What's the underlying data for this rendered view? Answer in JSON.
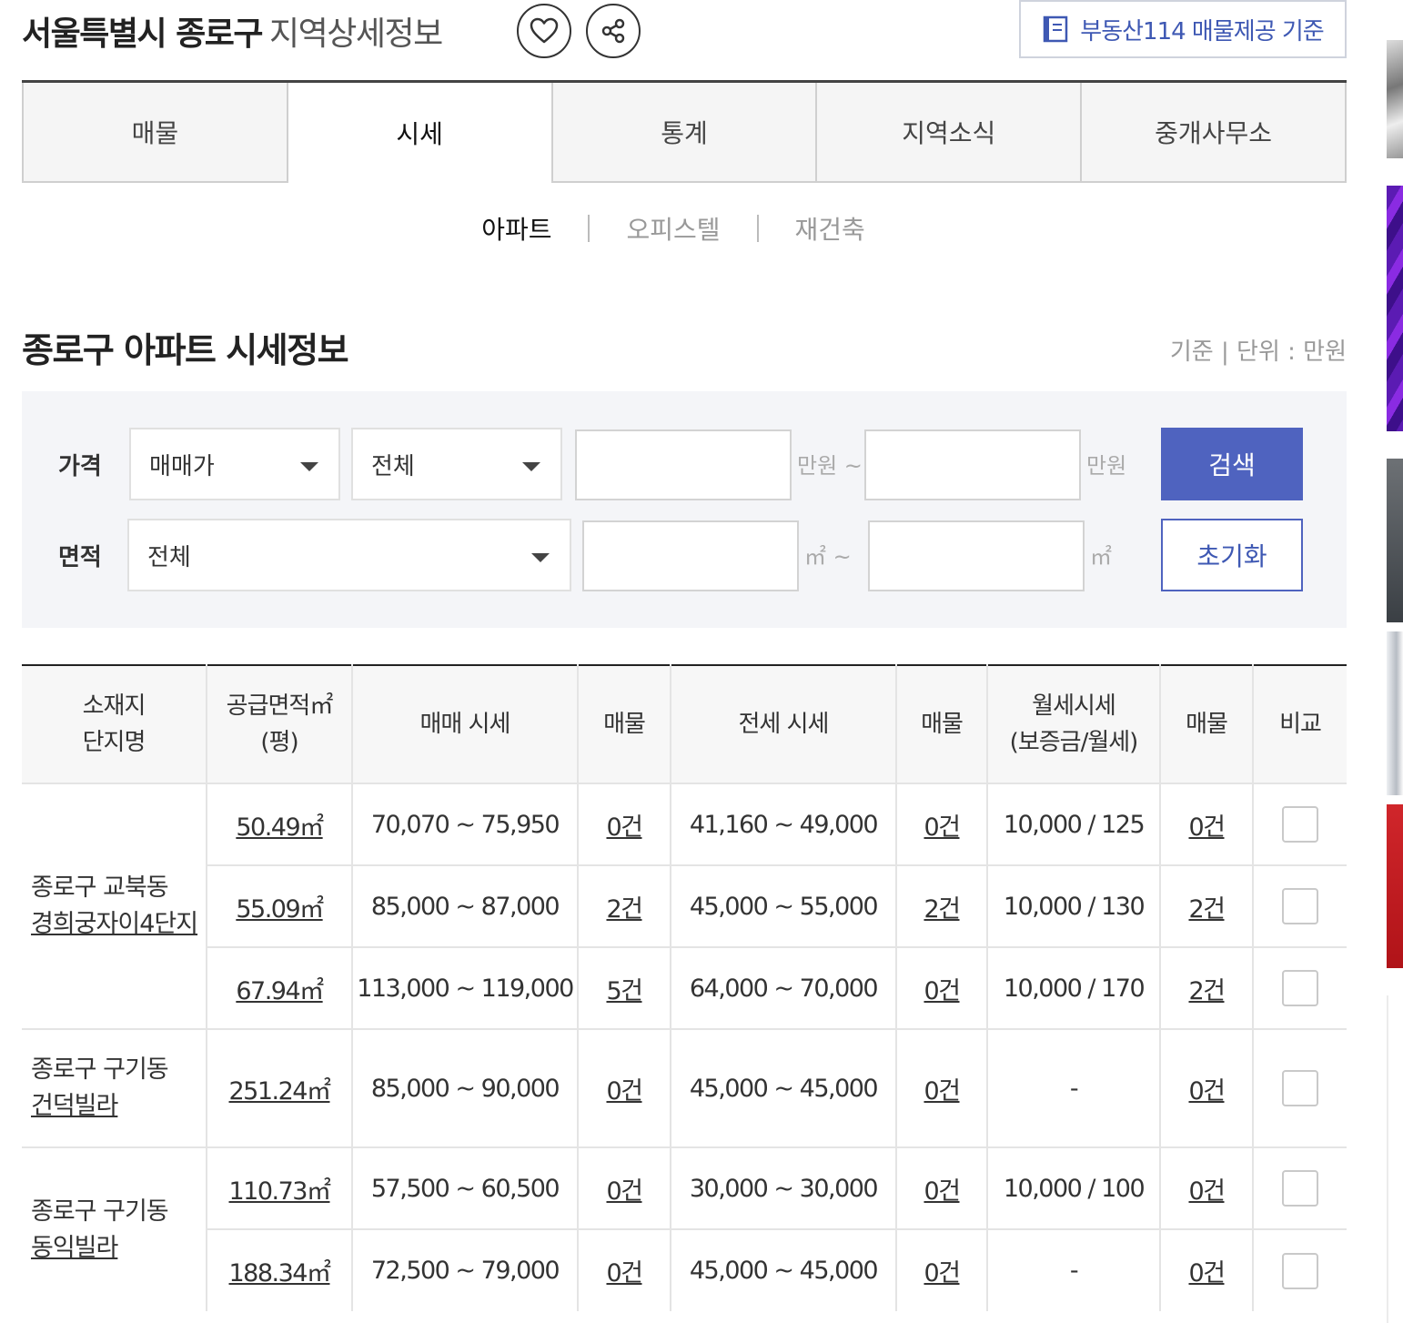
{
  "header": {
    "title_main": "서울특별시 종로구",
    "title_sub": "지역상세정보",
    "source_label": "부동산114 매물제공 기준"
  },
  "tabs": [
    {
      "label": "매물",
      "active": false
    },
    {
      "label": "시세",
      "active": true
    },
    {
      "label": "통계",
      "active": false
    },
    {
      "label": "지역소식",
      "active": false
    },
    {
      "label": "중개사무소",
      "active": false
    }
  ],
  "subtabs": [
    {
      "label": "아파트",
      "active": true
    },
    {
      "label": "오피스텔",
      "active": false
    },
    {
      "label": "재건축",
      "active": false
    }
  ],
  "section": {
    "title": "종로구 아파트 시세정보",
    "unit_note": "기준 | 단위 : 만원"
  },
  "filter": {
    "price_label": "가격",
    "area_label": "면적",
    "price_type": "매매가",
    "price_range": "전체",
    "area_range": "전체",
    "unit_manwon_tilde": "만원 ~",
    "unit_manwon": "만원",
    "unit_m2_tilde": "㎡ ~",
    "unit_m2": "㎡",
    "search_label": "검색",
    "reset_label": "초기화"
  },
  "table": {
    "headers": {
      "location_line1": "소재지",
      "location_line2": "단지명",
      "area_line1": "공급면적㎡",
      "area_line2": "(평)",
      "sale_price": "매매 시세",
      "listings": "매물",
      "jeonse_price": "전세 시세",
      "monthly_line1": "월세시세",
      "monthly_line2": "(보증금/월세)",
      "compare": "비교"
    },
    "groups": [
      {
        "district": "종로구 교북동",
        "complex": "경희궁자이4단지",
        "rows": [
          {
            "area": "50.49㎡",
            "sale": "70,070 ~ 75,950",
            "sale_count": "0건",
            "jeonse": "41,160 ~ 49,000",
            "jeonse_count": "0건",
            "monthly": "10,000 / 125",
            "monthly_count": "0건"
          },
          {
            "area": "55.09㎡",
            "sale": "85,000 ~ 87,000",
            "sale_count": "2건",
            "jeonse": "45,000 ~ 55,000",
            "jeonse_count": "2건",
            "monthly": "10,000 / 130",
            "monthly_count": "2건"
          },
          {
            "area": "67.94㎡",
            "sale": "113,000 ~ 119,000",
            "sale_count": "5건",
            "jeonse": "64,000 ~ 70,000",
            "jeonse_count": "0건",
            "monthly": "10,000 / 170",
            "monthly_count": "2건"
          }
        ]
      },
      {
        "district": "종로구 구기동",
        "complex": "건덕빌라",
        "rows": [
          {
            "area": "251.24㎡",
            "sale": "85,000 ~ 90,000",
            "sale_count": "0건",
            "jeonse": "45,000 ~ 45,000",
            "jeonse_count": "0건",
            "monthly": "-",
            "monthly_count": "0건"
          }
        ]
      },
      {
        "district": "종로구 구기동",
        "complex": "동익빌라",
        "rows": [
          {
            "area": "110.73㎡",
            "sale": "57,500 ~ 60,500",
            "sale_count": "0건",
            "jeonse": "30,000 ~ 30,000",
            "jeonse_count": "0건",
            "monthly": "10,000 / 100",
            "monthly_count": "0건"
          },
          {
            "area": "188.34㎡",
            "sale": "72,500 ~ 79,000",
            "sale_count": "0건",
            "jeonse": "45,000 ~ 45,000",
            "jeonse_count": "0건",
            "monthly": "-",
            "monthly_count": "0건"
          }
        ]
      }
    ]
  },
  "colors": {
    "accent": "#4f63bf",
    "accent_text": "#3e58b3"
  }
}
